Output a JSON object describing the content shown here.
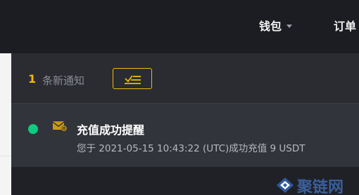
{
  "header": {
    "nav": [
      {
        "label": "钱包",
        "has_dropdown": true
      },
      {
        "label": "订单"
      }
    ]
  },
  "notifications": {
    "count": "1",
    "count_label": "条新通知",
    "mark_read_icon": "mark-all-read-icon",
    "items": [
      {
        "status": "unread",
        "status_color": "#0ecb81",
        "icon": "mail-settings-icon",
        "title": "充值成功提醒",
        "body": "您于 2021-05-15 10:43:22 (UTC)成功充值 9 USDT"
      }
    ]
  },
  "watermark": {
    "text": "聚链网"
  },
  "colors": {
    "accent": "#f0b90b",
    "unread": "#0ecb81",
    "background": "#1e2026"
  }
}
